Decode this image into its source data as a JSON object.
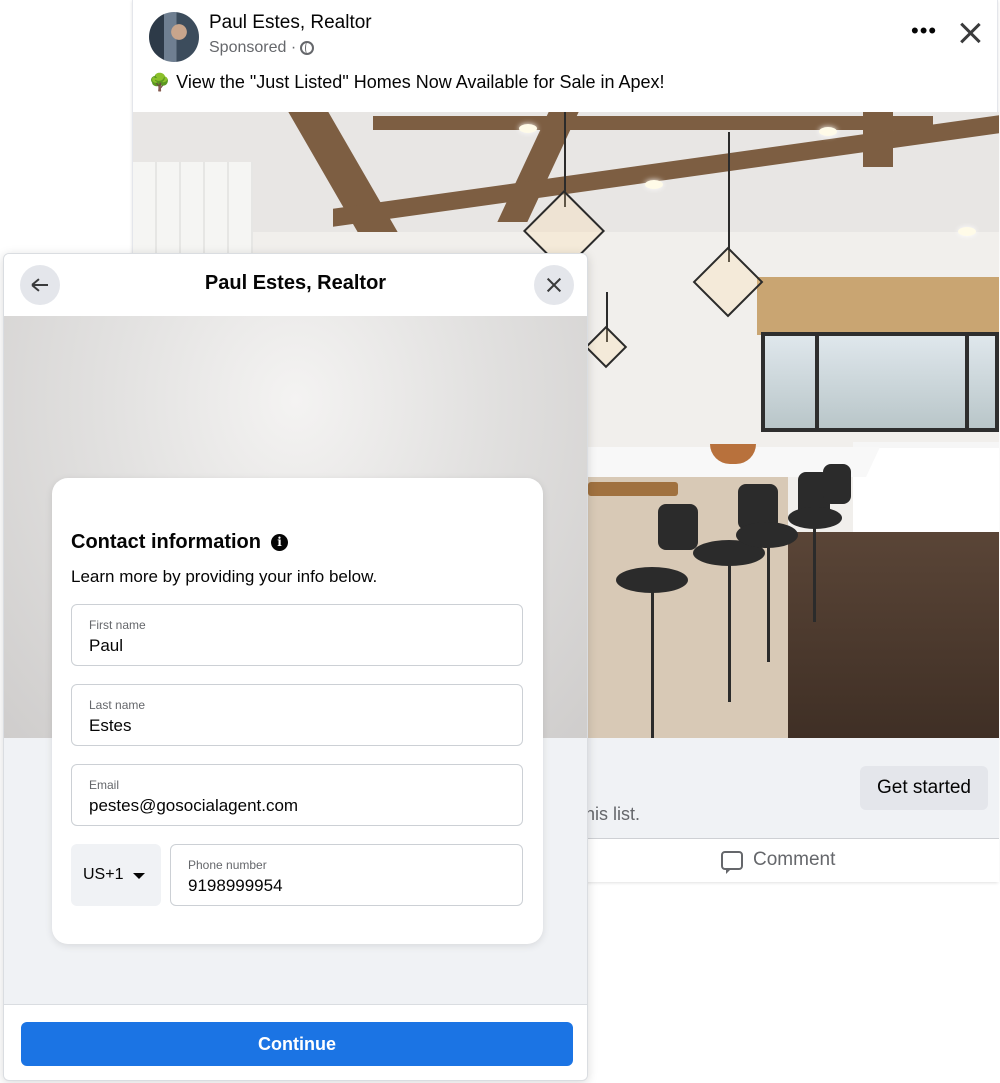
{
  "post": {
    "author": "Paul Estes, Realtor",
    "meta": "Sponsored ·",
    "more_label": "•••",
    "text_icon": "🌳",
    "text": "View the \"Just Listed\" Homes Now Available for Sale in Apex!",
    "cta_label": "Get started",
    "footer_subtext": "his list.",
    "comment_label": "Comment"
  },
  "modal": {
    "title": "Paul Estes, Realtor",
    "card": {
      "title": "Contact information",
      "info_icon": "i",
      "subtitle": "Learn more by providing your info below.",
      "fields": {
        "first_name": {
          "label": "First name",
          "value": "Paul"
        },
        "last_name": {
          "label": "Last name",
          "value": "Estes"
        },
        "email": {
          "label": "Email",
          "value": "pestes@gosocialagent.com"
        },
        "phone": {
          "label": "Phone number",
          "value": "9198999954"
        }
      },
      "country_code": "US+1"
    },
    "continue_label": "Continue"
  },
  "colors": {
    "primary_button": "#1b74e4",
    "background": "#f0f2f5",
    "secondary_text": "#65676b"
  },
  "icons": [
    "avatar",
    "globe-icon",
    "more-icon",
    "close-icon",
    "tree-icon",
    "comment-icon",
    "back-arrow-icon",
    "info-icon",
    "chevron-down-icon"
  ]
}
